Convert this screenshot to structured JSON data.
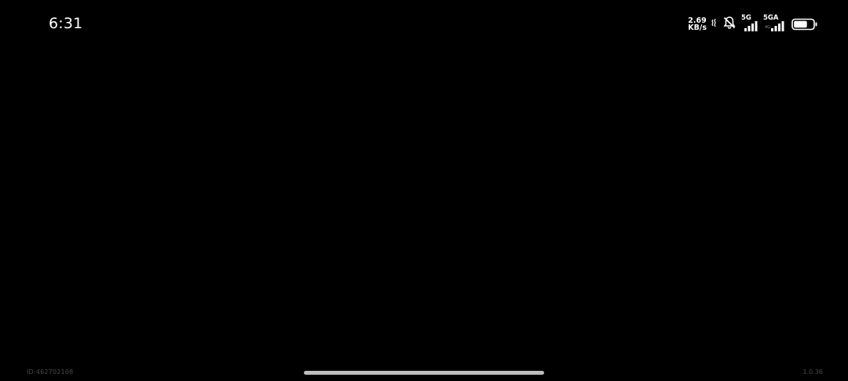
{
  "status_bar": {
    "time": "6:31",
    "net_speed_value": "2.69",
    "net_speed_unit": "KB/s",
    "icons": [
      "vibrate-icon",
      "muted-bell-icon"
    ],
    "sim1": {
      "network": "5G",
      "signal_bars": 4
    },
    "sim2": {
      "network": "5GA",
      "sub_label": "4G",
      "signal_bars": 4
    },
    "battery": {
      "level_fraction": 0.7,
      "icon": "battery-icon"
    }
  },
  "footer": {
    "id_text": "ID:462702108",
    "version": "1.0.36"
  },
  "colors": {
    "background": "#000000",
    "status_text": "#ffffff",
    "footer_text": "#4a4a4a",
    "home_indicator": "#bdbdbd"
  }
}
